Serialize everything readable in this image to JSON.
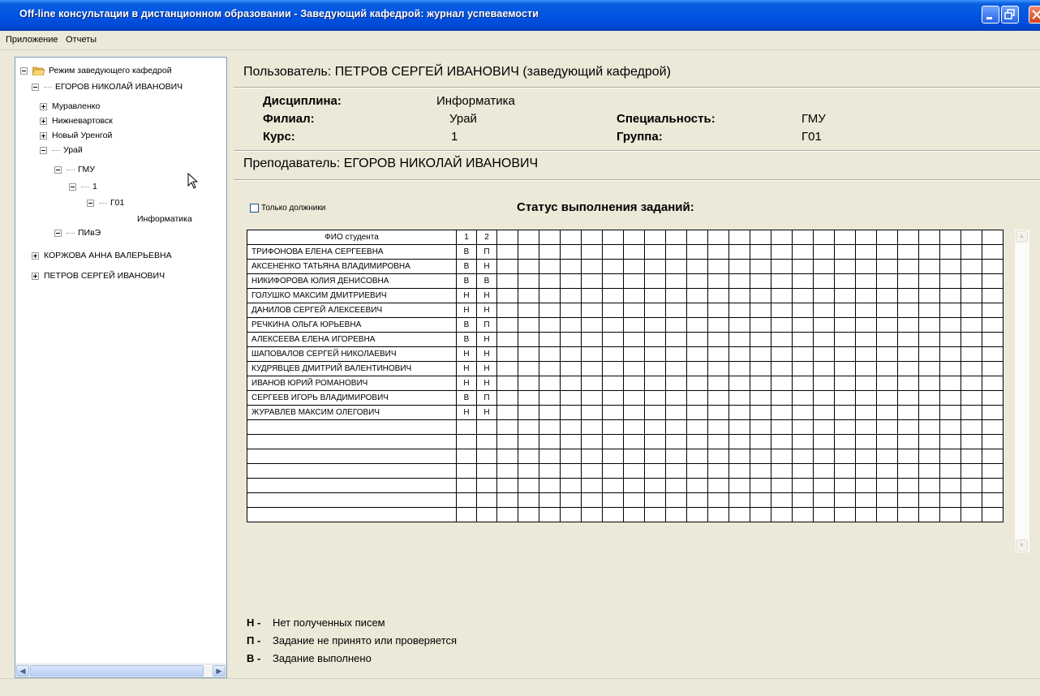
{
  "window": {
    "title": "Off-line консультации в дистанционном образовании - Заведующий кафедрой: журнал успеваемости"
  },
  "menu": {
    "items": [
      "Приложение",
      "Отчеты"
    ]
  },
  "tree": {
    "root": "Режим заведующего кафедрой",
    "teacher1": "ЕГОРОВ НИКОЛАЙ ИВАНОВИЧ",
    "branch1": "Муравленко",
    "branch2": "Нижневартовск",
    "branch3": "Новый Уренгой",
    "branch4": "Урай",
    "spec1": "ГМУ",
    "course": "1",
    "group": "Г01",
    "discipline": "Информатика",
    "spec2": "ПИвЭ",
    "teacher2": "КОРЖОВА АННА ВАЛЕРЬЕВНА",
    "teacher3": "ПЕТРОВ СЕРГЕЙ ИВАНОВИЧ"
  },
  "header": {
    "user": "Пользователь: ПЕТРОВ СЕРГЕЙ ИВАНОВИЧ (заведующий кафедрой)",
    "discipline_label": "Дисциплина:",
    "discipline_value": "Информатика",
    "branch_label": "Филиал:",
    "branch_value": "Урай",
    "course_label": "Курс:",
    "course_value": "1",
    "specialty_label": "Специальность:",
    "specialty_value": "ГМУ",
    "group_label": "Группа:",
    "group_value": "Г01",
    "teacher": "Преподаватель: ЕГОРОВ НИКОЛАЙ ИВАНОВИЧ"
  },
  "filter": {
    "debtors_only_label": "Только должники",
    "checked": false
  },
  "status_title": "Статус выполнения заданий:",
  "table": {
    "name_header": "ФИО студента",
    "task_headers": [
      "1",
      "2"
    ],
    "extra_columns": 24,
    "empty_rows": 7,
    "rows": [
      {
        "name": "ТРИФОНОВА ЕЛЕНА СЕРГЕЕВНА",
        "t1": "В",
        "t2": "П"
      },
      {
        "name": "АКСЕНЕНКО ТАТЬЯНА ВЛАДИМИРОВНА",
        "t1": "В",
        "t2": "Н"
      },
      {
        "name": "НИКИФОРОВА ЮЛИЯ ДЕНИСОВНА",
        "t1": "В",
        "t2": "В"
      },
      {
        "name": "ГОЛУШКО МАКСИМ ДМИТРИЕВИЧ",
        "t1": "Н",
        "t2": "Н"
      },
      {
        "name": "ДАНИЛОВ СЕРГЕЙ АЛЕКСЕЕВИЧ",
        "t1": "Н",
        "t2": "Н"
      },
      {
        "name": "РЕЧКИНА ОЛЬГА ЮРЬЕВНА",
        "t1": "В",
        "t2": "П"
      },
      {
        "name": "АЛЕКСЕЕВА ЕЛЕНА ИГОРЕВНА",
        "t1": "В",
        "t2": "Н"
      },
      {
        "name": "ШАПОВАЛОВ СЕРГЕЙ НИКОЛАЕВИЧ",
        "t1": "Н",
        "t2": "Н"
      },
      {
        "name": "КУДРЯВЦЕВ ДМИТРИЙ ВАЛЕНТИНОВИЧ",
        "t1": "Н",
        "t2": "Н"
      },
      {
        "name": "ИВАНОВ ЮРИЙ РОМАНОВИЧ",
        "t1": "Н",
        "t2": "Н"
      },
      {
        "name": "СЕРГЕЕВ ИГОРЬ ВЛАДИМИРОВИЧ",
        "t1": "В",
        "t2": "П"
      },
      {
        "name": "ЖУРАВЛЕВ МАКСИМ ОЛЕГОВИЧ",
        "t1": "Н",
        "t2": "Н"
      }
    ]
  },
  "legend": [
    {
      "key": "Н -",
      "text": "Нет полученных писем"
    },
    {
      "key": "П -",
      "text": "Задание не принято или проверяется"
    },
    {
      "key": "В -",
      "text": "Задание выполнено"
    }
  ]
}
